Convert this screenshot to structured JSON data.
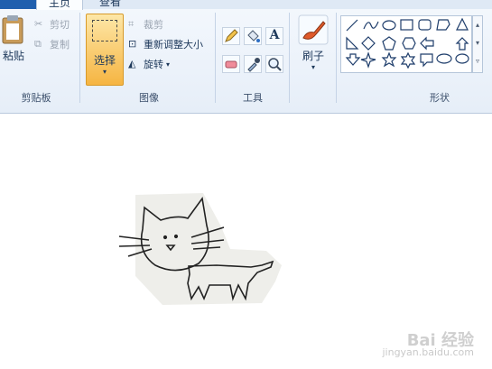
{
  "tabs": {
    "file": "",
    "home": "主页",
    "view": "查看"
  },
  "clipboard": {
    "paste": "粘贴",
    "cut": "剪切",
    "copy": "复制",
    "label": "剪贴板"
  },
  "image": {
    "select": "选择",
    "crop": "裁剪",
    "resize": "重新调整大小",
    "rotate": "旋转",
    "label": "图像"
  },
  "tools": {
    "label": "工具"
  },
  "brushes": {
    "label": "刷子"
  },
  "shapes": {
    "label": "形状"
  },
  "watermark": {
    "brand": "Bai 经验",
    "url": "jingyan.baidu.com"
  },
  "colors": {
    "accent": "#f6b542",
    "ribbon": "#e6eef8",
    "text": "#1e395b"
  }
}
